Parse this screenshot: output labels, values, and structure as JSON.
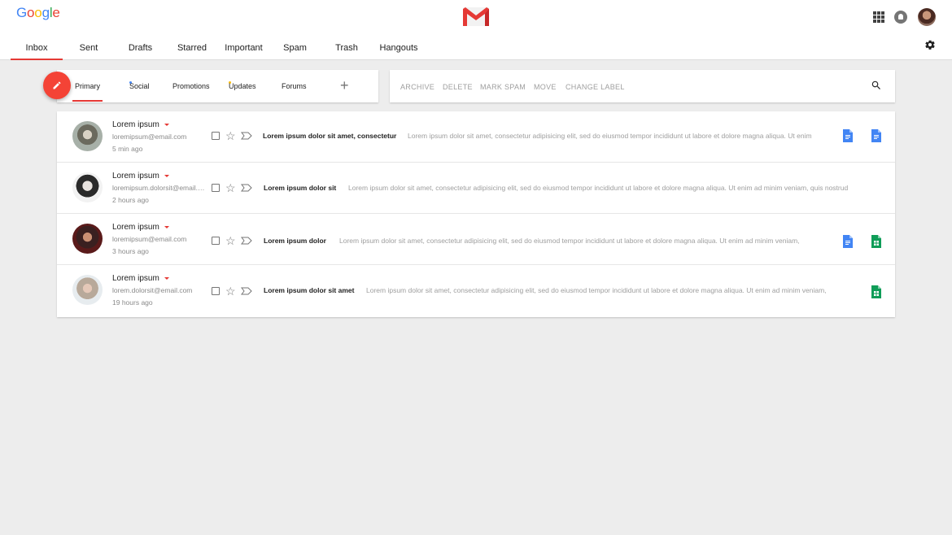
{
  "header": {
    "logo_text": "Google",
    "logo_colors": [
      "#4285F4",
      "#EA4335",
      "#FBBC05",
      "#4285F4",
      "#34A853",
      "#EA4335"
    ],
    "nav": [
      {
        "label": "Inbox",
        "active": true
      },
      {
        "label": "Sent",
        "active": false
      },
      {
        "label": "Drafts",
        "active": false
      },
      {
        "label": "Starred",
        "active": false
      },
      {
        "label": "Important",
        "active": false
      },
      {
        "label": "Spam",
        "active": false
      },
      {
        "label": "Trash",
        "active": false
      },
      {
        "label": "Hangouts",
        "active": false
      }
    ]
  },
  "tabs": [
    {
      "label": "Primary",
      "active": true
    },
    {
      "label": "Social",
      "active": false
    },
    {
      "label": "Promotions",
      "active": false
    },
    {
      "label": "Updates",
      "active": false
    },
    {
      "label": "Forums",
      "active": false
    }
  ],
  "actions": [
    "ARCHIVE",
    "DELETE",
    "MARK SPAM",
    "MOVE",
    "CHANGE LABEL"
  ],
  "emails": [
    {
      "sender": "Lorem ipsum",
      "email": "loremipsum@email.com",
      "time": "5 min ago",
      "subject": "Lorem ipsum dolor sit amet, consectetur",
      "snippet": "Lorem ipsum dolor sit amet, consectetur adipisicing elit, sed do eiusmod tempor incididunt ut labore et dolore magna aliqua. Ut enim",
      "attachments": [
        "doc",
        "doc"
      ]
    },
    {
      "sender": "Lorem ipsum",
      "email": "loremipsum.dolorsit@email.com",
      "time": "2 hours ago",
      "subject": "Lorem ipsum dolor sit",
      "snippet": "Lorem ipsum dolor sit amet, consectetur adipisicing elit, sed do eiusmod tempor incididunt ut labore et dolore magna aliqua. Ut enim ad minim veniam, quis nostrud",
      "attachments": []
    },
    {
      "sender": "Lorem ipsum",
      "email": "loremipsum@email.com",
      "time": "3 hours ago",
      "subject": "Lorem ipsum dolor",
      "snippet": "Lorem ipsum dolor sit amet, consectetur adipisicing elit, sed do eiusmod tempor incididunt ut labore et dolore magna aliqua. Ut enim ad minim veniam,",
      "attachments": [
        "doc",
        "sheet"
      ]
    },
    {
      "sender": "Lorem ipsum",
      "email": "lorem.dolorsit@email.com",
      "time": "19 hours ago",
      "subject": "Lorem ipsum dolor sit amet",
      "snippet": "Lorem ipsum dolor sit amet, consectetur adipisicing elit, sed do eiusmod tempor incididunt ut labore et dolore magna aliqua. Ut enim ad minim veniam,",
      "attachments": [
        "sheet"
      ]
    }
  ],
  "colors": {
    "accent": "#e53935",
    "fab": "#f44336",
    "doc_blue": "#4285F4",
    "sheet_green": "#0F9D58"
  },
  "icons": {
    "compose": "pencil-icon",
    "search": "search-icon",
    "settings": "gear-icon",
    "apps": "apps-grid-icon",
    "notifications": "bell-icon"
  }
}
